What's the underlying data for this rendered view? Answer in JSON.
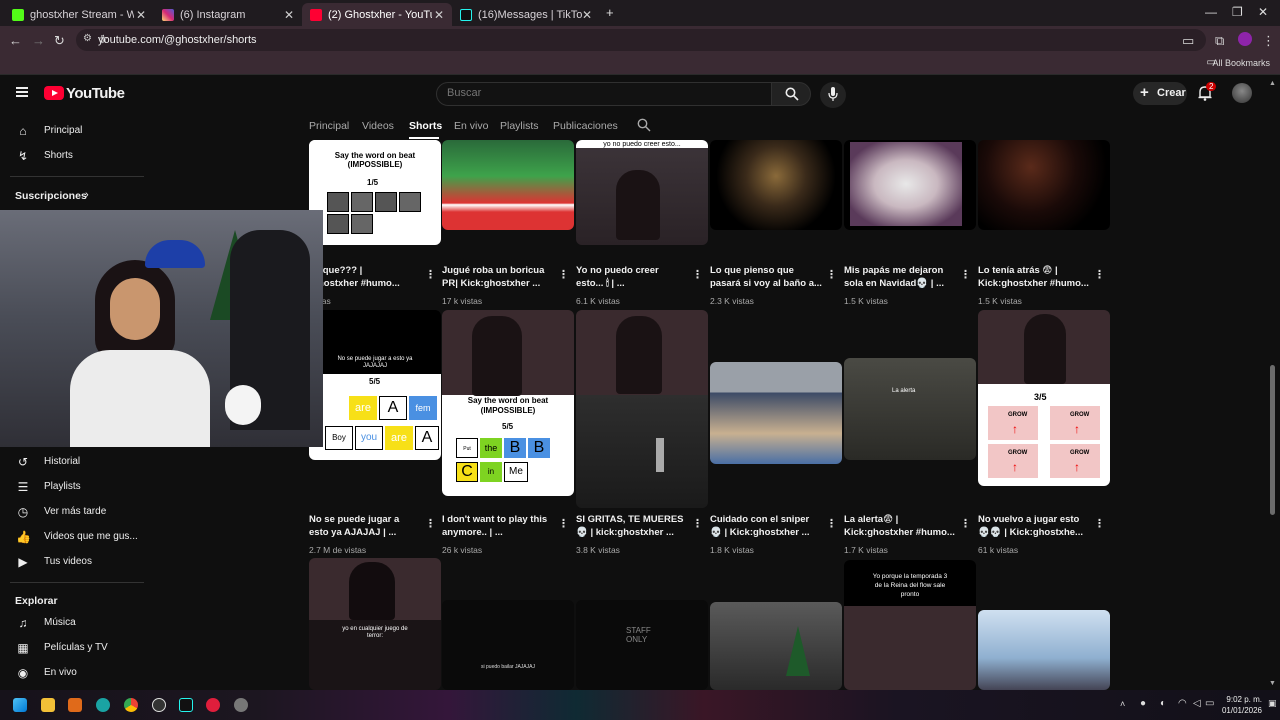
{
  "browser": {
    "tabs": [
      {
        "title": "ghostxher Stream - Watch Live",
        "favicon_color": "#53fc18",
        "active": false
      },
      {
        "title": "(6) Instagram",
        "favicon_color": "#d6249f",
        "active": false
      },
      {
        "title": "(2) Ghostxher - YouTube",
        "favicon_color": "#ff0033",
        "active": true
      },
      {
        "title": "(16)Messages | TikTok",
        "favicon_color": "#25f4ee",
        "active": false
      }
    ],
    "new_tab": "+",
    "url": "youtube.com/@ghostxher/shorts",
    "bookmarks_label": "All Bookmarks"
  },
  "header": {
    "logo_text": "YouTube",
    "search_placeholder": "Buscar",
    "create_label": "Crear",
    "notification_count": "2"
  },
  "sidebar": {
    "top": [
      {
        "label": "Principal",
        "icon": "home-icon"
      },
      {
        "label": "Shorts",
        "icon": "shorts-icon"
      }
    ],
    "subscriptions_label": "Suscripciones",
    "you_items": [
      {
        "label": "Historial",
        "icon": "history-icon"
      },
      {
        "label": "Playlists",
        "icon": "playlists-icon"
      },
      {
        "label": "Ver más tarde",
        "icon": "watch-later-icon"
      },
      {
        "label": "Videos que me gus...",
        "icon": "like-icon"
      },
      {
        "label": "Tus videos",
        "icon": "your-videos-icon"
      }
    ],
    "explore_label": "Explorar",
    "explore_items": [
      {
        "label": "Música",
        "icon": "music-icon"
      },
      {
        "label": "Películas y TV",
        "icon": "movies-icon"
      },
      {
        "label": "En vivo",
        "icon": "live-icon"
      }
    ]
  },
  "channel_tabs": [
    "Principal",
    "Videos",
    "Shorts",
    "En vivo",
    "Playlists",
    "Publicaciones"
  ],
  "active_channel_tab": "Shorts",
  "shorts": [
    {
      "title": "dy que??? |\n:ghostxher #humo...",
      "views": "vistas",
      "overlay_text": "Say the word on beat\n(IMPOSSIBLE)",
      "overlay_sub": "1/5"
    },
    {
      "title": "Jugué roba un boricua\nPR| Kick:ghostxher ...",
      "views": "17 k vistas"
    },
    {
      "title": "Yo no puedo creer\nesto... 🕯 | ...",
      "views": "6.1 K vistas",
      "overlay_text": "yo no puedo creer esto..."
    },
    {
      "title": "Lo que pienso que\npasará si voy al baño a...",
      "views": "2.3 K vistas"
    },
    {
      "title": "Mis papás me dejaron\nsola en Navidad💀 | ...",
      "views": "1.5 K vistas"
    },
    {
      "title": "Lo tenía atrás 😨 |\nKick:ghostxher #humo...",
      "views": "1.5 K vistas"
    },
    {
      "title": "No se puede jugar a\nesto ya AJAJAJ | ...",
      "views": "2.7 M de vistas",
      "overlay_text": "No se puede jugar a esto ya\nJAJAJAJ",
      "overlay_sub": "5/5"
    },
    {
      "title": "I don't want to play this\nanymore.. | ...",
      "views": "26 k vistas",
      "overlay_text": "Say the word on beat\n(IMPOSSIBLE)",
      "overlay_sub": "5/5"
    },
    {
      "title": "SI GRITAS, TE MUERES\n💀 | kick:ghostxher ...",
      "views": "3.8 K vistas"
    },
    {
      "title": "Cuidado con el sniper\n💀 | Kick:ghostxher ...",
      "views": "1.8 K vistas"
    },
    {
      "title": "La alerta😨 |\nKick:ghostxher #humo...",
      "views": "1.7 K vistas",
      "overlay_text": "La alerta"
    },
    {
      "title": "No vuelvo a jugar esto\n💀💀 | Kick:ghostxhe...",
      "views": "61 k vistas",
      "overlay_sub": "3/5"
    },
    {
      "overlay_text": "yo en cualquier juego de\nterror:"
    },
    {
      "overlay_text": "si puedo bailar JAJAJAJ"
    },
    {
      "overlay_text": "STAFF\nONLY"
    },
    {},
    {
      "overlay_text": "Yo porque la temporada 3\nde la Reina del flow sale\npronto"
    },
    {}
  ],
  "word_game": {
    "words": [
      "are",
      "A",
      "fem",
      "Boy",
      "you",
      "are",
      "A"
    ],
    "words2": [
      "Put",
      "the",
      "B",
      "B",
      "C",
      "in",
      "Me"
    ],
    "grow": [
      "GROW",
      "GROW",
      "GROW",
      "GROW"
    ]
  },
  "watermark": "KICK:ghostxher",
  "taskbar": {
    "time": "9:02 p. m.",
    "date": "01/01/2026"
  }
}
